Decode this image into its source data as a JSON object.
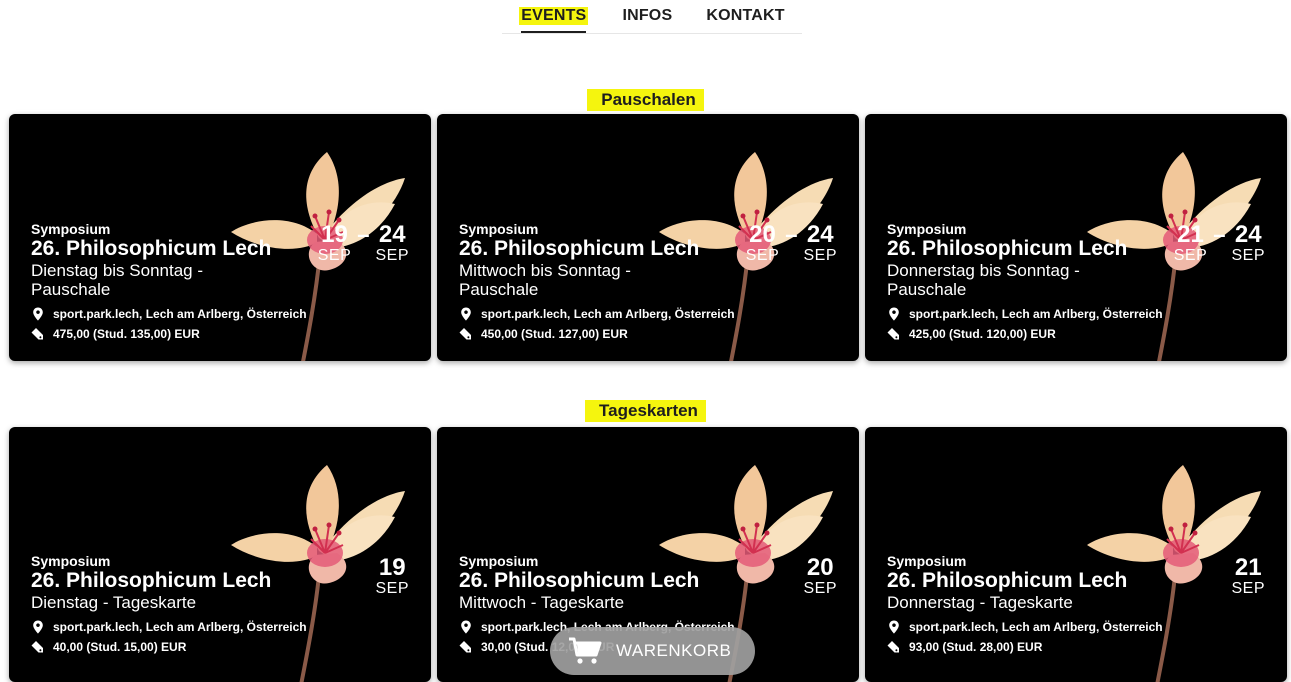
{
  "nav": {
    "items": [
      {
        "label": "EVENTS",
        "active": true
      },
      {
        "label": "INFOS",
        "active": false
      },
      {
        "label": "KONTAKT",
        "active": false
      }
    ]
  },
  "sections": [
    {
      "title": "Pauschalen",
      "cards": [
        {
          "category": "Symposium",
          "title": "26. Philosophicum Lech",
          "subtitle": "Dienstag bis Sonntag -",
          "subtitle2": "Pauschale",
          "location": "sport.park.lech, Lech am Arlberg, Österreich",
          "price": "475,00 (Stud. 135,00) EUR",
          "date_from_day": "19",
          "date_from_month": "SEP",
          "date_sep": "–",
          "date_to_day": "24",
          "date_to_month": "SEP"
        },
        {
          "category": "Symposium",
          "title": "26. Philosophicum Lech",
          "subtitle": "Mittwoch bis Sonntag -",
          "subtitle2": "Pauschale",
          "location": "sport.park.lech, Lech am Arlberg, Österreich",
          "price": "450,00 (Stud. 127,00) EUR",
          "date_from_day": "20",
          "date_from_month": "SEP",
          "date_sep": "–",
          "date_to_day": "24",
          "date_to_month": "SEP"
        },
        {
          "category": "Symposium",
          "title": "26. Philosophicum Lech",
          "subtitle": "Donnerstag bis Sonntag -",
          "subtitle2": "Pauschale",
          "location": "sport.park.lech, Lech am Arlberg, Österreich",
          "price": "425,00 (Stud. 120,00) EUR",
          "date_from_day": "21",
          "date_from_month": "SEP",
          "date_sep": "–",
          "date_to_day": "24",
          "date_to_month": "SEP"
        }
      ]
    },
    {
      "title": "Tageskarten",
      "cards": [
        {
          "category": "Symposium",
          "title": "26. Philosophicum Lech",
          "subtitle": "Dienstag - Tageskarte",
          "location": "sport.park.lech, Lech am Arlberg, Österreich",
          "price": "40,00 (Stud. 15,00) EUR",
          "date_day": "19",
          "date_month": "SEP"
        },
        {
          "category": "Symposium",
          "title": "26. Philosophicum Lech",
          "subtitle": "Mittwoch - Tageskarte",
          "location": "sport.park.lech, Lech am Arlberg, Österreich",
          "price": "30,00 (Stud. 12,00) EUR",
          "date_day": "20",
          "date_month": "SEP"
        },
        {
          "category": "Symposium",
          "title": "26. Philosophicum Lech",
          "subtitle": "Donnerstag - Tageskarte",
          "location": "sport.park.lech, Lech am Arlberg, Österreich",
          "price": "93,00 (Stud. 28,00) EUR",
          "date_day": "21",
          "date_month": "SEP"
        }
      ]
    }
  ],
  "cart": {
    "label": "WARENKORB",
    "icon": "cart-icon"
  },
  "icons": {
    "location": "location-pin-icon",
    "price": "ticket-icon",
    "image": "flower-image"
  },
  "colors": {
    "highlight": "#f5f50e",
    "card_bg": "#000000",
    "text": "#1e1e1e",
    "cart_bg": "#a0a0a0"
  }
}
